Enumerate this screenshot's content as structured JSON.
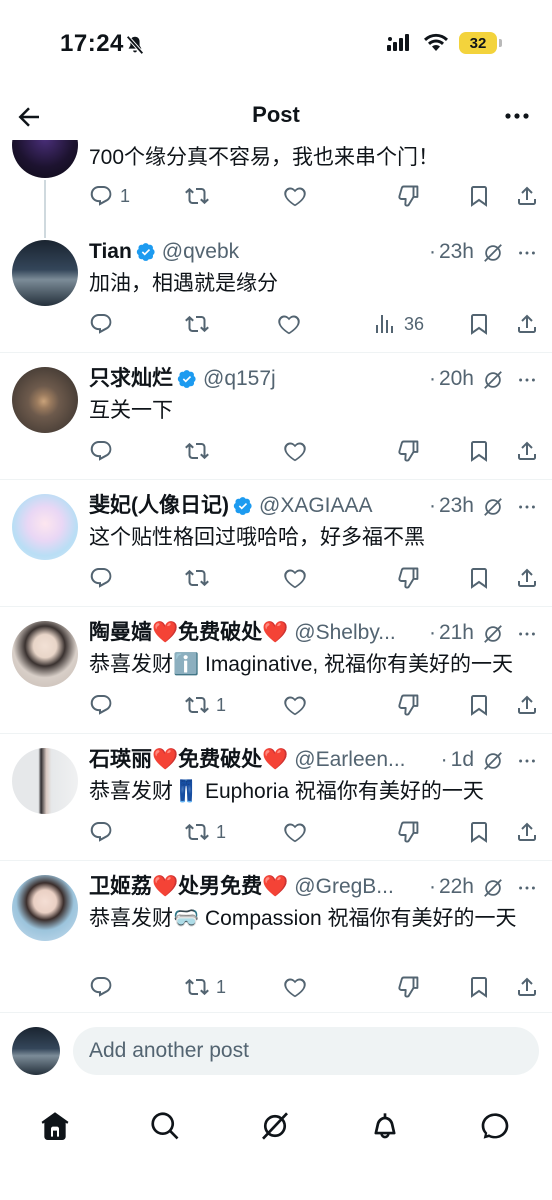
{
  "status_bar": {
    "time": "17:24",
    "battery": "32"
  },
  "header": {
    "title": "Post"
  },
  "posts": [
    {
      "text": "700个缘分真不容易，我也来串个门！",
      "actions": {
        "reply": "1",
        "repost": "",
        "like": ""
      }
    },
    {
      "name": "Tian",
      "handle": "@qvebk",
      "time": "23h",
      "text": "加油，相遇就是缘分",
      "actions": {
        "reply": "",
        "repost": "",
        "like": "",
        "views": "36"
      }
    },
    {
      "name": "只求灿烂",
      "handle": "@q157j",
      "time": "20h",
      "text": "互关一下",
      "actions": {
        "reply": "",
        "repost": "",
        "like": ""
      }
    },
    {
      "name": "斐妃(人像日记)",
      "handle": "@XAGIAAA",
      "time": "23h",
      "text": "这个贴性格回过哦哈哈，好多福不黑",
      "actions": {
        "reply": "",
        "repost": "",
        "like": ""
      }
    },
    {
      "name": "陶曼嫱❤️免费破处❤️",
      "handle": "@Shelby...",
      "time": "21h",
      "text": "恭喜发财ℹ️ Imaginative, 祝福你有美好的一天",
      "actions": {
        "reply": "",
        "repost": "1",
        "like": ""
      }
    },
    {
      "name": "石瑛丽❤️免费破处❤️",
      "handle": "@Earleen...",
      "time": "1d",
      "text": "恭喜发财👖 Euphoria 祝福你有美好的一天",
      "actions": {
        "reply": "",
        "repost": "1",
        "like": ""
      }
    },
    {
      "name": "卫姬荔❤️处男免费❤️",
      "handle": "@GregB...",
      "time": "22h",
      "text": "恭喜发财🥽 Compassion 祝福你有美好的一天",
      "actions": {
        "reply": "",
        "repost": "1",
        "like": ""
      }
    }
  ],
  "reply_bar": {
    "placeholder": "Add another post"
  },
  "colors": {
    "accent": "#1d9bf0",
    "text": "#0f1419",
    "secondary": "#536471",
    "heart": "#e0245e"
  },
  "icons": [
    "back-arrow-icon",
    "more-icon",
    "reply-icon",
    "repost-icon",
    "like-icon",
    "views-icon",
    "downvote-icon",
    "bookmark-icon",
    "share-icon",
    "grok-icon",
    "verified-icon",
    "home-icon",
    "search-icon",
    "notifications-icon",
    "messages-icon"
  ]
}
